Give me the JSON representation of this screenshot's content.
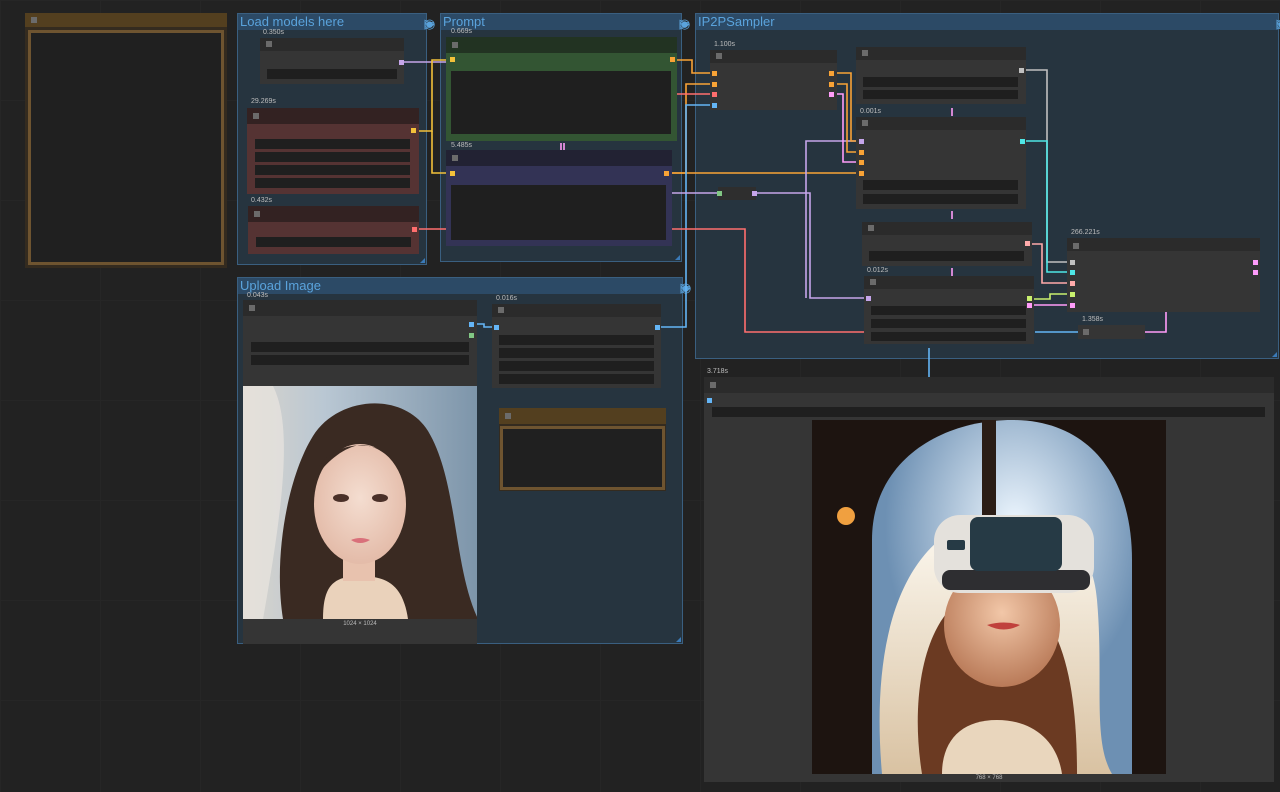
{
  "groups": {
    "load_models": {
      "title": "Load models here"
    },
    "prompt": {
      "title": "Prompt"
    },
    "ip2p": {
      "title": "IP2PSampler"
    },
    "upload": {
      "title": "Upload Image"
    }
  },
  "group_icons": [
    "play-icon",
    "pin-icon",
    "eye-icon"
  ],
  "group_icon_glyphs": {
    "play": "▷",
    "pin": "⊸",
    "eye": "◉"
  },
  "timings": {
    "n_a": "0.350s",
    "n_b": "29.269s",
    "n_c": "0.432s",
    "n_d": "0.669s",
    "n_e": "5.485s",
    "n_f": "1.100s",
    "n_g": "0.001s",
    "n_h": "0.012s",
    "n_i": "266.221s",
    "n_j": "1.358s",
    "n_k": "0.043s",
    "n_l": "0.016s",
    "n_m": "3.718s"
  },
  "images": {
    "input_caption": "1024 × 1024",
    "output_caption": "768 × 768"
  },
  "colors": {
    "model_port": "#c5a5ea",
    "clip_port": "#f3c13a",
    "vae_port": "#ff6e6e",
    "conditioning_port": "#f9a336",
    "image_port": "#64b5f6",
    "latent_port": "#ff9cf9",
    "mask_port": "#81c784",
    "group_border": "#3a5f80",
    "group_title": "#5aa3dc"
  }
}
